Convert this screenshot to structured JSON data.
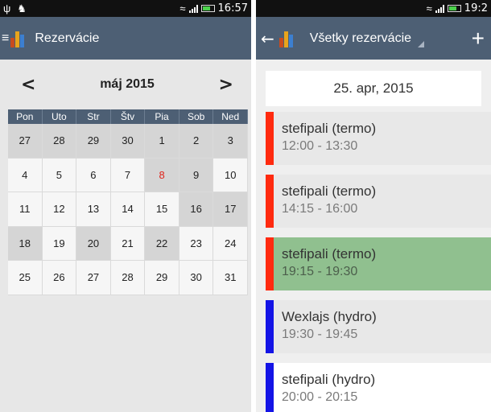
{
  "left": {
    "status": {
      "time": "16:57"
    },
    "title": "Rezervácie",
    "calendar": {
      "month": "máj 2015",
      "prev": "<",
      "next": ">",
      "weekdays": [
        "Pon",
        "Uto",
        "Str",
        "Štv",
        "Pia",
        "Sob",
        "Ned"
      ],
      "days": [
        {
          "d": "27",
          "grey": true
        },
        {
          "d": "28",
          "grey": true
        },
        {
          "d": "29",
          "grey": true
        },
        {
          "d": "30",
          "grey": true
        },
        {
          "d": "1",
          "grey": true
        },
        {
          "d": "2",
          "grey": true
        },
        {
          "d": "3",
          "grey": true
        },
        {
          "d": "4"
        },
        {
          "d": "5"
        },
        {
          "d": "6"
        },
        {
          "d": "7"
        },
        {
          "d": "8",
          "grey": true,
          "today": true
        },
        {
          "d": "9",
          "grey": true
        },
        {
          "d": "10"
        },
        {
          "d": "11"
        },
        {
          "d": "12"
        },
        {
          "d": "13"
        },
        {
          "d": "14"
        },
        {
          "d": "15"
        },
        {
          "d": "16",
          "grey": true
        },
        {
          "d": "17",
          "grey": true
        },
        {
          "d": "18",
          "grey": true
        },
        {
          "d": "19"
        },
        {
          "d": "20",
          "grey": true
        },
        {
          "d": "21"
        },
        {
          "d": "22",
          "grey": true
        },
        {
          "d": "23"
        },
        {
          "d": "24"
        },
        {
          "d": "25"
        },
        {
          "d": "26"
        },
        {
          "d": "27"
        },
        {
          "d": "28"
        },
        {
          "d": "29"
        },
        {
          "d": "30"
        },
        {
          "d": "31"
        }
      ]
    }
  },
  "right": {
    "status": {
      "time": "19:2"
    },
    "back": "←",
    "title": "Všetky rezervácie",
    "add": "+",
    "date": "25. apr, 2015",
    "items": [
      {
        "name": "stefipali (termo)",
        "time": "12:00 - 13:30",
        "style": "red"
      },
      {
        "name": "stefipali (termo)",
        "time": "14:15 - 16:00",
        "style": "red"
      },
      {
        "name": "stefipali (termo)",
        "time": "19:15 - 19:30",
        "style": "red green"
      },
      {
        "name": "Wexlajs (hydro)",
        "time": "19:30 - 19:45",
        "style": "blue"
      },
      {
        "name": "stefipali (hydro)",
        "time": "20:00 - 20:15",
        "style": "blue white"
      }
    ]
  },
  "colors": {
    "actionbar": "#4d5f74",
    "today": "#e0241b",
    "termo": "#ff2a0f",
    "hydro": "#1414e6",
    "selected": "#90c08f"
  }
}
